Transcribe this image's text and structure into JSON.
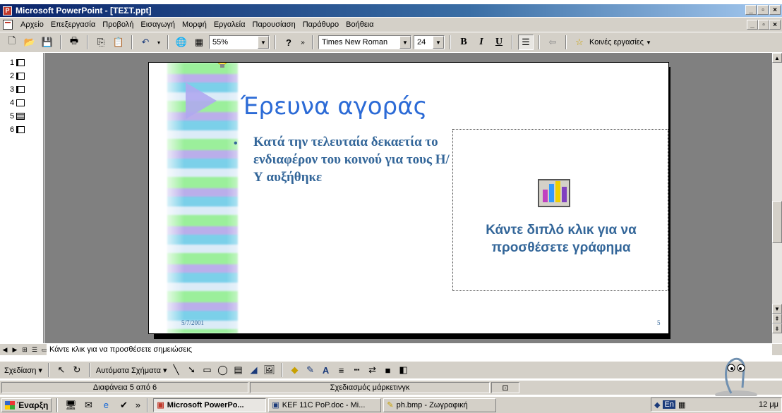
{
  "window": {
    "title": "Microsoft PowerPoint - [ΤΕΣΤ.ppt]",
    "buttons": [
      "_",
      "▫",
      "×"
    ]
  },
  "menu": {
    "items": [
      "Αρχείο",
      "Επεξεργασία",
      "Προβολή",
      "Εισαγωγή",
      "Μορφή",
      "Εργαλεία",
      "Παρουσίαση",
      "Παράθυρο",
      "Βοήθεια"
    ]
  },
  "toolbar": {
    "zoom": "55%",
    "font_name": "Times New Roman",
    "font_size": "24",
    "bold": "B",
    "italic": "I",
    "underline": "U",
    "common_tasks": "Κοινές εργασίες"
  },
  "outline": {
    "slides": [
      "1",
      "2",
      "3",
      "4",
      "5",
      "6"
    ]
  },
  "slide": {
    "title": "Έρευνα αγοράς",
    "bullet": "Κατά την τελευταία δεκαετία το ενδιαφέρον του κοινού για τους Η/Υ αυξήθηκε",
    "chart_placeholder": "Κάντε διπλό κλικ για να προσθέσετε γράφημα",
    "date": "5/7/2001",
    "number": "5"
  },
  "notes": {
    "placeholder": "Κάντε κλικ για να προσθέσετε σημειώσεις"
  },
  "drawing_toolbar": {
    "draw": "Σχεδίαση",
    "autoshapes": "Αυτόματα Σχήματα"
  },
  "status": {
    "slide_info": "Διαφάνεια 5 από 6",
    "design": "Σχεδιασμός μάρκετινγκ"
  },
  "taskbar": {
    "start": "Έναρξη",
    "tasks": [
      {
        "label": "Microsoft PowerPo...",
        "active": true
      },
      {
        "label": "KEF 11C PoP.doc - Mi...",
        "active": false
      },
      {
        "label": "ph.bmp - Ζωγραφική",
        "active": false
      }
    ],
    "lang": "En",
    "clock": "12 μμ"
  },
  "colors": {
    "title_blue": "#2c6bd6",
    "body_blue": "#336699",
    "titlebar": "#0a246a"
  }
}
